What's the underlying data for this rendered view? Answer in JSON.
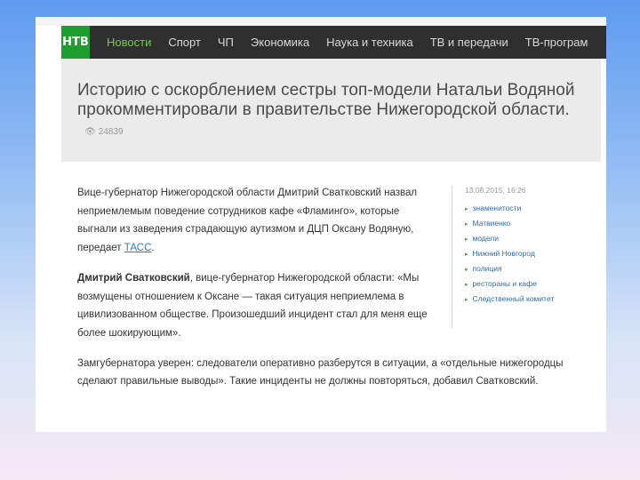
{
  "nav": {
    "logo": "НТВ",
    "items": [
      {
        "label": "Новости",
        "active": true
      },
      {
        "label": "Спорт",
        "active": false
      },
      {
        "label": "ЧП",
        "active": false
      },
      {
        "label": "Экономика",
        "active": false
      },
      {
        "label": "Наука и техника",
        "active": false
      },
      {
        "label": "ТВ и передачи",
        "active": false
      },
      {
        "label": "ТВ-програм",
        "active": false
      }
    ]
  },
  "article": {
    "headline": "Историю с оскорблением сестры топ-модели Натальи Водяной прокомментировали в правительстве Нижегородской области.",
    "views": "24839",
    "para1": "Вице-губернатор Нижегородской области Дмитрий Сватковский назвал неприемлемым поведение сотрудников кафе «Фламинго», которые выгнали из заведения страдающую аутизмом и ДЦП Оксану Водяную, передает ",
    "tass_link": "ТАСС",
    "para1_end": ".",
    "para2_bold": "Дмитрий Сватковский",
    "para2": ", вице-губернатор Нижегородской области: «Мы возмущены отношением к Оксане — такая ситуация неприемлема в цивилизованном обществе. Произошедший инцидент стал для меня еще более шокирующим».",
    "para3": "Замгубернатора уверен: следователи оперативно разберутся в ситуации, а «отдельные нижегородцы сделают правильные выводы». Такие инциденты не должны повторяться, добавил Сватковский."
  },
  "sidebar": {
    "date": "13.08.2015, 16:26",
    "tags": [
      "знаменитости",
      "Матвиенко",
      "модели",
      "Нижний Новгород",
      "полиция",
      "рестораны и кафе",
      "Следственный комитет"
    ]
  },
  "colors": {
    "nav_bg": "#2f2f2f",
    "logo_bg": "#1f9d2e",
    "active_nav": "#6fd04a",
    "link": "#2a7bbf"
  }
}
